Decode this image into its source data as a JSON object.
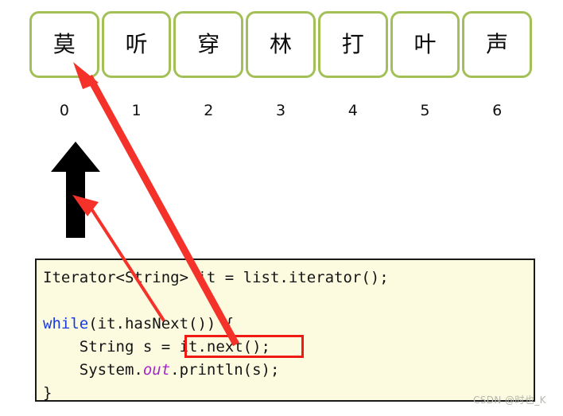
{
  "collection": {
    "label": "list-elements",
    "box_border_color": "#a2c056",
    "cells": [
      {
        "char": "莫",
        "index": "0"
      },
      {
        "char": "听",
        "index": "1"
      },
      {
        "char": "穿",
        "index": "2"
      },
      {
        "char": "林",
        "index": "3"
      },
      {
        "char": "打",
        "index": "4"
      },
      {
        "char": "叶",
        "index": "5"
      },
      {
        "char": "声",
        "index": "6"
      }
    ]
  },
  "cursor": {
    "icon": "up-arrow-icon",
    "color": "#000000",
    "points_at_index": "0"
  },
  "annotations": {
    "accent_color": "#f01a14",
    "arrows": [
      {
        "name": "next-returns-element-arrow",
        "from": "it.next();",
        "to": "element-box-0",
        "style": "thick"
      },
      {
        "name": "hasnext-checks-cursor-arrow",
        "from": "it.hasNext()",
        "to": "cursor-arrow",
        "style": "thin"
      }
    ],
    "highlight_box": {
      "name": "it-next-highlight",
      "target_text": "it.next();",
      "color": "#f01a14"
    }
  },
  "code": {
    "background": "#fcfbe0",
    "border_color": "#1a1a1a",
    "keyword_color": "#1a39e0",
    "field_color": "#a626c7",
    "lines": {
      "l1_a": "Iterator<String> it = list.iterator();",
      "l2": "",
      "l3_kw": "while",
      "l3_rest": "(it.hasNext()) {",
      "l4": "    String s = it.next();",
      "l5_a": "    System.",
      "l5_field": "out",
      "l5_b": ".println(s);",
      "l6": "}"
    }
  },
  "watermark": {
    "text": "CSDN @时也_K"
  }
}
